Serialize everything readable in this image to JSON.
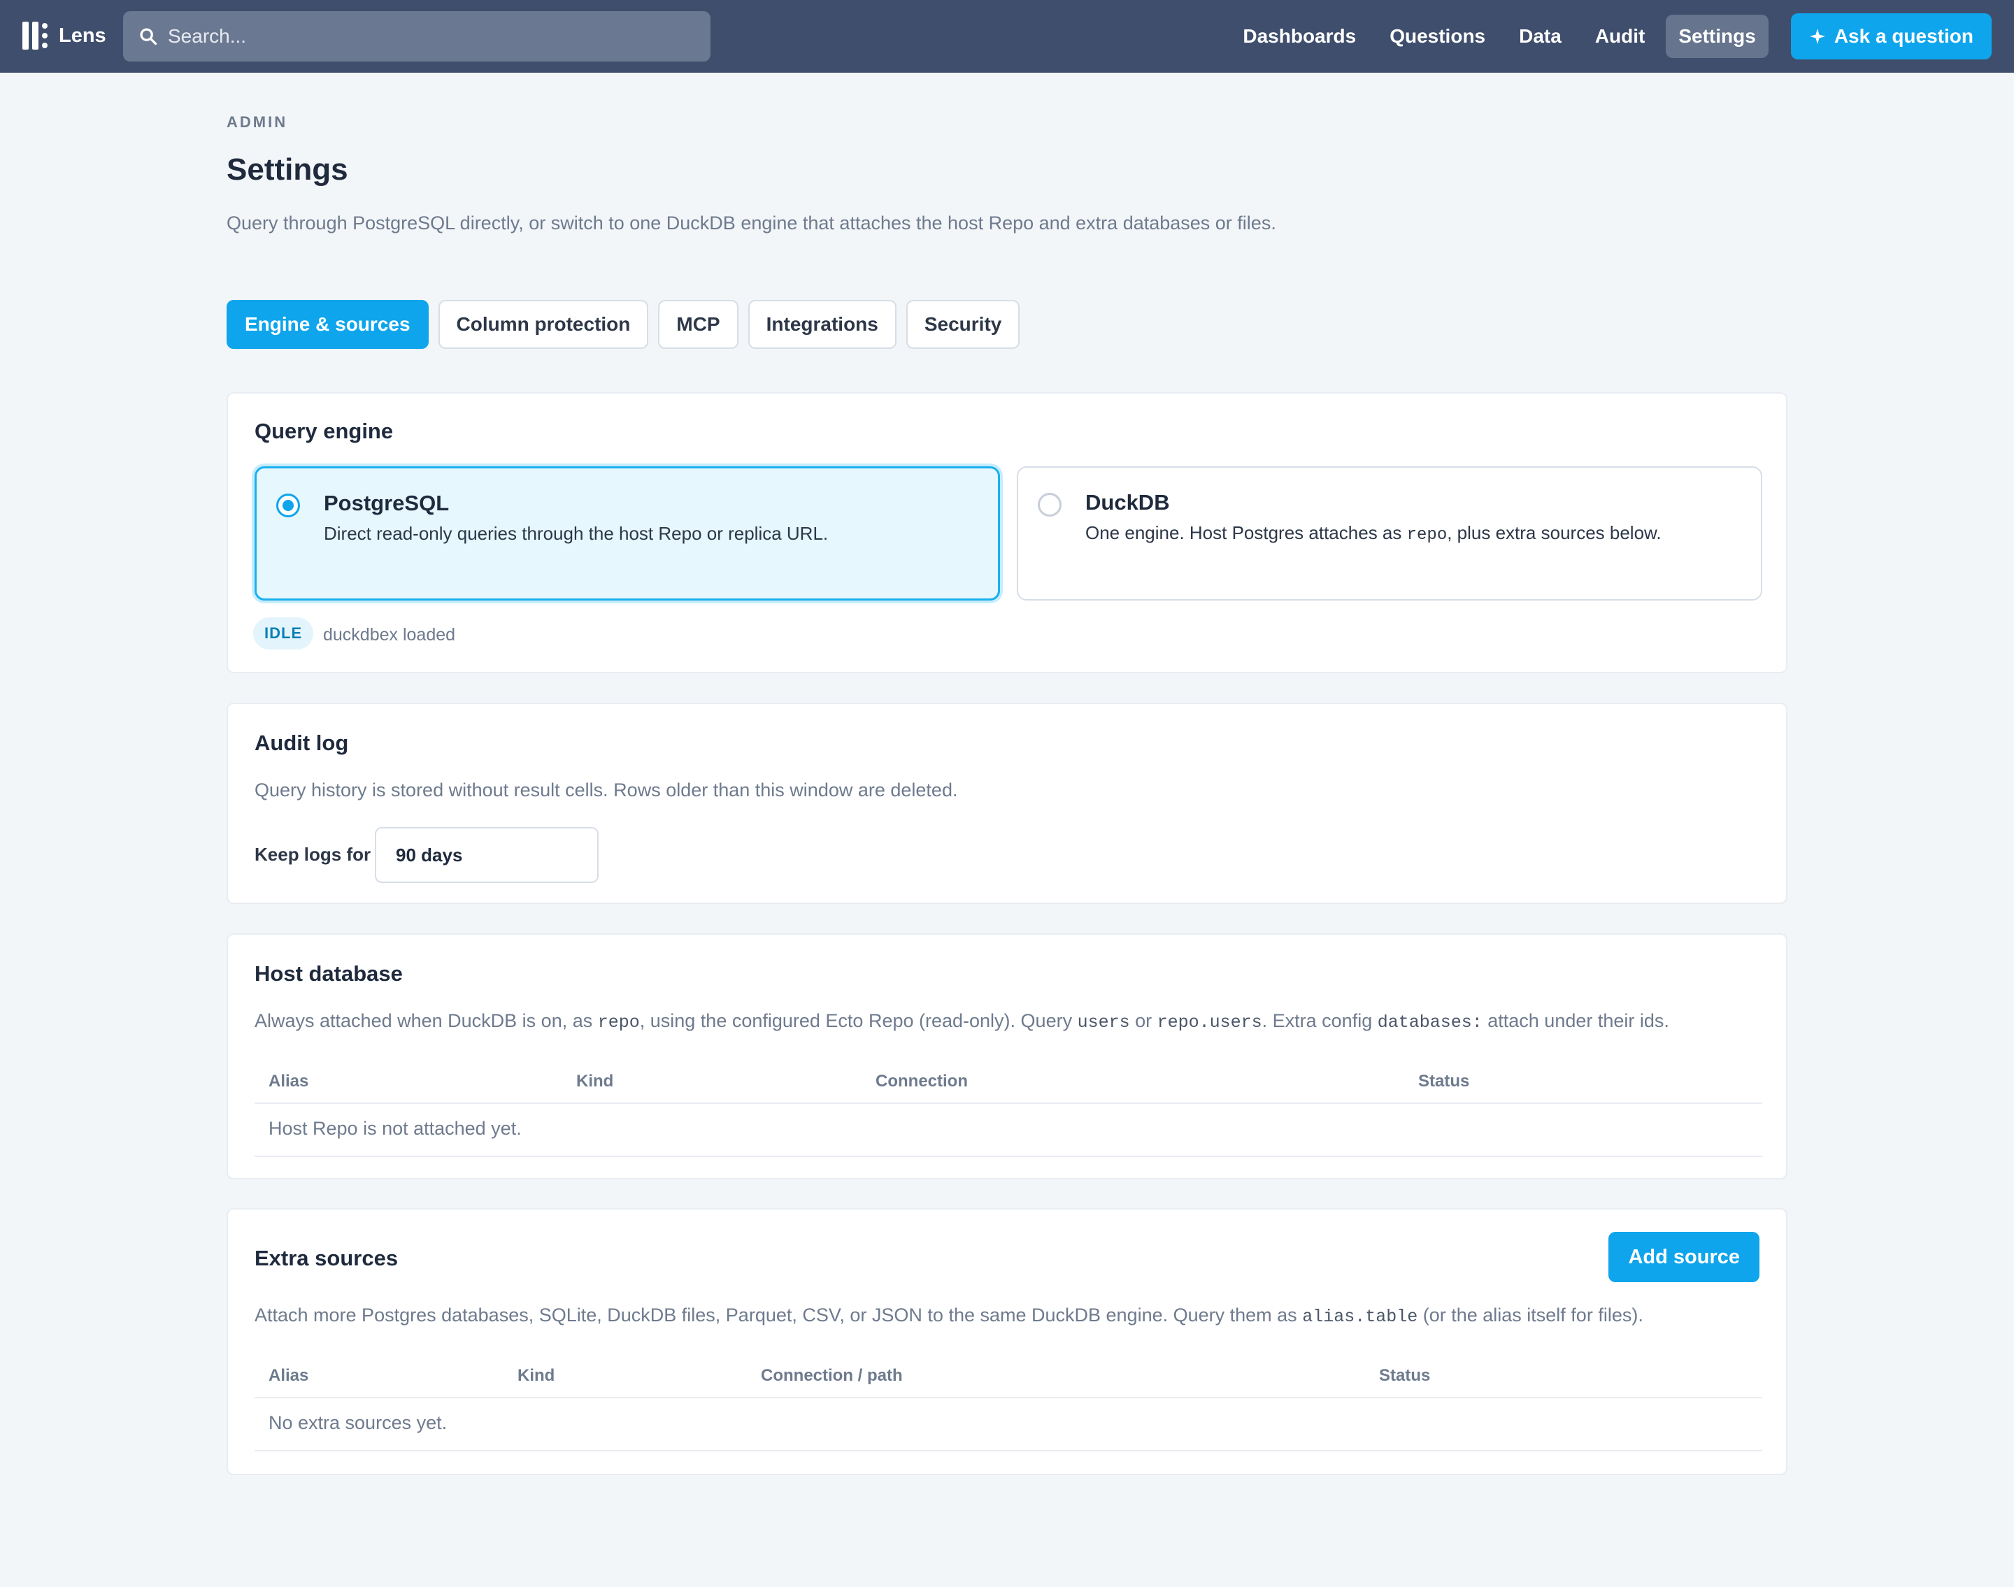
{
  "app": {
    "name": "Lens"
  },
  "search": {
    "placeholder": "Search..."
  },
  "nav": {
    "items": [
      "Dashboards",
      "Questions",
      "Data",
      "Audit",
      "Settings"
    ],
    "active": "Settings",
    "ask_label": "Ask a question"
  },
  "page": {
    "eyebrow": "ADMIN",
    "title": "Settings",
    "subtitle": "Query through PostgreSQL directly, or switch to one DuckDB engine that attaches the host Repo and extra databases or files."
  },
  "tabs": [
    "Engine & sources",
    "Column protection",
    "MCP",
    "Integrations",
    "Security"
  ],
  "query_engine": {
    "title": "Query engine",
    "options": [
      {
        "name": "PostgreSQL",
        "desc": "Direct read-only queries through the host Repo or replica URL.",
        "selected": true
      },
      {
        "name": "DuckDB",
        "desc_before": "One engine. Host Postgres attaches as ",
        "desc_code": "repo",
        "desc_after": ", plus extra sources below.",
        "selected": false
      }
    ],
    "status_badge": "IDLE",
    "status_text": "duckdbex loaded"
  },
  "audit_log": {
    "title": "Audit log",
    "desc": "Query history is stored without result cells. Rows older than this window are deleted.",
    "keep_label": "Keep logs for",
    "keep_value": "90 days"
  },
  "host_db": {
    "title": "Host database",
    "desc_parts": [
      "Always attached when DuckDB is on, as ",
      "repo",
      ", using the configured Ecto Repo (read-only). Query ",
      "users",
      " or ",
      "repo.users",
      ". Extra config ",
      "databases:",
      " attach under their ids."
    ],
    "columns": [
      "Alias",
      "Kind",
      "Connection",
      "Status"
    ],
    "empty": "Host Repo is not attached yet."
  },
  "extra_sources": {
    "title": "Extra sources",
    "add_label": "Add source",
    "desc_parts": [
      "Attach more Postgres databases, SQLite, DuckDB files, Parquet, CSV, or JSON to the same DuckDB engine. Query them as ",
      "alias.table",
      " (or the alias itself for files)."
    ],
    "columns": [
      "Alias",
      "Kind",
      "Connection / path",
      "Status"
    ],
    "empty": "No extra sources yet."
  },
  "colors": {
    "topbar": "#3f4e6c",
    "accent": "#0ea5ec",
    "background": "#f3f6f9"
  }
}
